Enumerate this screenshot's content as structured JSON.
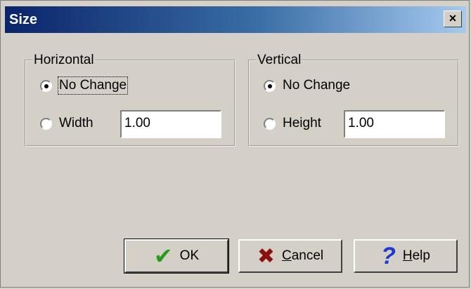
{
  "window": {
    "title": "Size",
    "close_label": "×"
  },
  "horizontal": {
    "legend": "Horizontal",
    "option_no_change": "No Change",
    "option_width": "Width",
    "width_value": "1.00",
    "selected": "No Change"
  },
  "vertical": {
    "legend": "Vertical",
    "option_no_change": "No Change",
    "option_height": "Height",
    "height_value": "1.00",
    "selected": "No Change"
  },
  "buttons": {
    "ok": "OK",
    "cancel": {
      "accel": "C",
      "rest": "ancel"
    },
    "help": {
      "accel": "H",
      "rest": "elp"
    }
  },
  "icons": {
    "ok": "checkmark-icon",
    "cancel": "x-icon",
    "help": "question-icon"
  }
}
